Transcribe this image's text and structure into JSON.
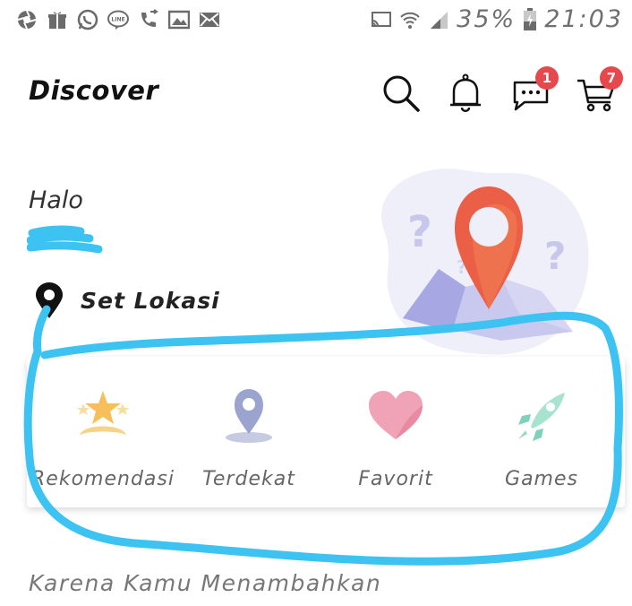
{
  "status_bar": {
    "battery": "35%",
    "time": "21:03",
    "icons_left": [
      "aperture-icon",
      "gift-icon",
      "whatsapp-icon",
      "line-icon",
      "missed-call-icon",
      "gallery-icon",
      "mail-icon"
    ],
    "icons_right": [
      "cast-icon",
      "wifi-icon",
      "signal-icon",
      "battery-icon"
    ]
  },
  "header": {
    "title": "Discover",
    "chat_badge": "1",
    "cart_badge": "7"
  },
  "greeting": {
    "hello": "Halo",
    "location_label": "Set Lokasi"
  },
  "categories": [
    {
      "label": "Rekomendasi",
      "icon": "star-trophy-icon"
    },
    {
      "label": "Terdekat",
      "icon": "map-pin-icon"
    },
    {
      "label": "Favorit",
      "icon": "heart-icon"
    },
    {
      "label": "Games",
      "icon": "rocket-icon"
    }
  ],
  "section": {
    "title": "Karena Kamu Menambahkan"
  },
  "colors": {
    "badge": "#e5484d",
    "annotation": "#3cc3f2"
  }
}
